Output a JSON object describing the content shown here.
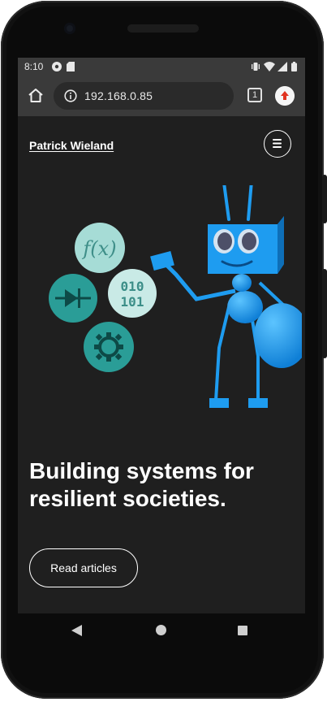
{
  "status_bar": {
    "time": "8:10"
  },
  "browser": {
    "url": "192.168.0.85",
    "tab_count": "1"
  },
  "site": {
    "brand": "Patrick Wieland",
    "headline_line1": "Building systems for",
    "headline_line2": "resilient societies.",
    "cta_label": "Read articles",
    "hero": {
      "bubble_fx": "f(x)",
      "bubble_binary_line1": "010",
      "bubble_binary_line2": "101"
    }
  },
  "colors": {
    "accent_teal": "#2a9d97",
    "robot_blue": "#1e9cf0",
    "page_bg": "#1f1f1f",
    "browser_chrome": "#3a3a3a"
  }
}
